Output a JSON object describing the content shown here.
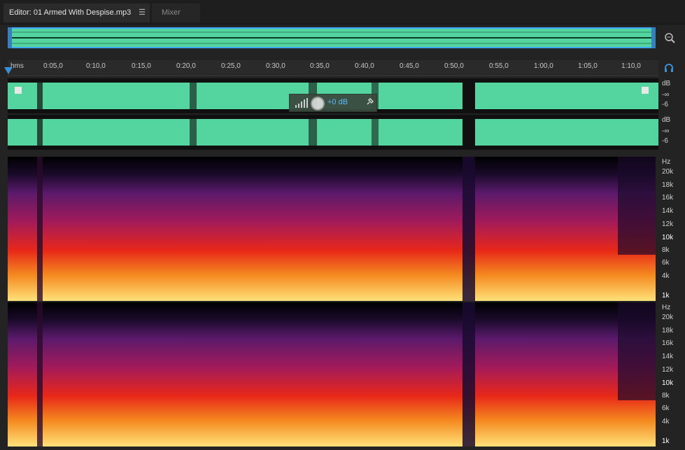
{
  "tabs": {
    "editor_label": "Editor: 01 Armed With Despise.mp3",
    "menu_glyph": "☰",
    "mixer_label": "Mixer"
  },
  "ruler": {
    "unit": "hms",
    "ticks": [
      "0:05,0",
      "0:10,0",
      "0:15,0",
      "0:20,0",
      "0:25,0",
      "0:30,0",
      "0:35,0",
      "0:40,0",
      "0:45,0",
      "0:50,0",
      "0:55,0",
      "1:00,0",
      "1:05,0",
      "1:10,0"
    ]
  },
  "waveform": {
    "ch1": {
      "unit": "dB",
      "top": "-∞",
      "mid": "-6"
    },
    "ch2": {
      "unit": "dB",
      "top": "-∞",
      "mid": "-6"
    }
  },
  "hud": {
    "gain": "+0 dB"
  },
  "spectral": {
    "unit": "Hz",
    "labels": [
      "20k",
      "18k",
      "16k",
      "14k",
      "12k",
      "10k",
      "8k",
      "6k",
      "4k",
      "1k"
    ]
  },
  "icons": [
    "zoom-icon",
    "headphones-icon",
    "volume-bars-icon",
    "gain-knob-icon",
    "pin-icon",
    "fade-handle-icon"
  ],
  "colors": {
    "waveform": "#54d49e",
    "overview_border": "#3fa7ff",
    "accent": "#3c8ed6"
  }
}
